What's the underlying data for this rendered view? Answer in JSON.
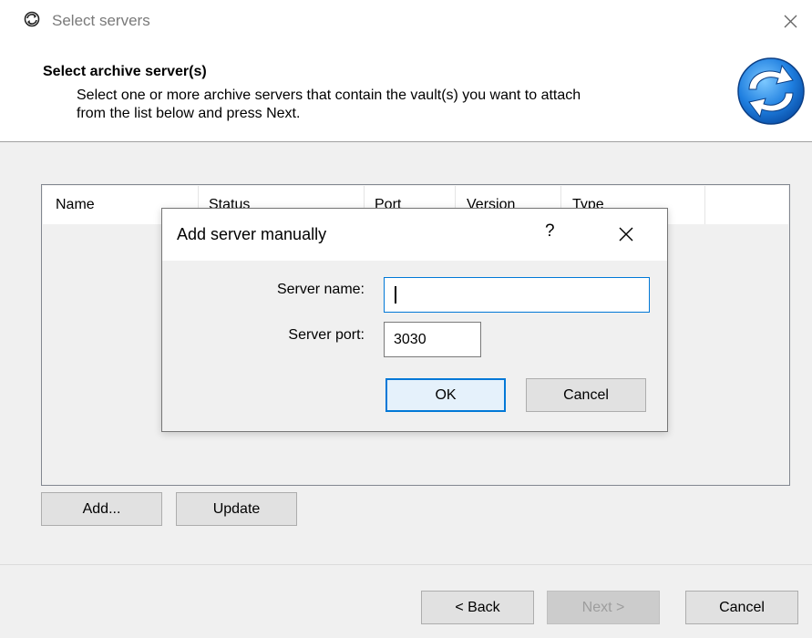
{
  "window": {
    "title": "Select servers"
  },
  "header": {
    "title": "Select archive server(s)",
    "description_line1": "Select one or more archive servers that contain the vault(s) you want to attach",
    "description_line2": "from the list below and press Next."
  },
  "server_list": {
    "columns": [
      "Name",
      "Status",
      "Port",
      "Version",
      "Type"
    ],
    "rows": []
  },
  "list_buttons": {
    "add_label": "Add...",
    "update_label": "Update"
  },
  "footer": {
    "back_label": "< Back",
    "next_label": "Next >",
    "cancel_label": "Cancel"
  },
  "dialog": {
    "title": "Add server manually",
    "help_label": "?",
    "server_name_label": "Server name:",
    "server_name_value": "",
    "server_port_label": "Server port:",
    "server_port_value": "3030",
    "ok_label": "OK",
    "cancel_label": "Cancel"
  },
  "icons": {
    "app": "refresh-globe-icon",
    "header": "refresh-arrows-icon",
    "close": "close-icon"
  },
  "colors": {
    "accent": "#0078d7",
    "panel": "#f0f0f0"
  }
}
